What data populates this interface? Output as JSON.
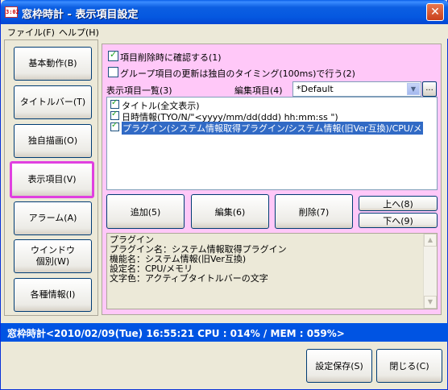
{
  "window": {
    "title": "窓枠時計 - 表示項目設定",
    "icon_text": "3:02",
    "close_glyph": "✕"
  },
  "menu": {
    "file": "ファイル(F)",
    "help": "ヘルプ(H)"
  },
  "nav": {
    "items": [
      {
        "label": "基本動作(B)"
      },
      {
        "label": "タイトルバー(T)"
      },
      {
        "label": "独自描画(O)"
      },
      {
        "label": "表示項目(V)"
      },
      {
        "label": "アラーム(A)"
      },
      {
        "label": "ウインドウ\n個別(W)"
      },
      {
        "label": "各種情報(I)"
      }
    ],
    "selected_index": 3
  },
  "options": {
    "confirm_delete": {
      "label": "項目削除時に確認する(1)",
      "checked": true
    },
    "group_update": {
      "label": "グループ項目の更新は独自のタイミング(100ms)で行う(2)",
      "checked": false
    }
  },
  "list": {
    "title": "表示項目一覧(3)",
    "edit_label": "編集項目(4)",
    "edit_value": "*Default",
    "more_button": "...",
    "rows": [
      {
        "text": "タイトル(全文表示)",
        "checked": true,
        "selected": false
      },
      {
        "text": "日時情報(TYO/N/\"<yyyy/mm/dd(ddd) hh:mm:ss \")",
        "checked": true,
        "selected": false
      },
      {
        "text": "プラグイン(システム情報取得プラグイン/システム情報(旧Ver互換)/CPU/メ",
        "checked": true,
        "selected": true
      }
    ]
  },
  "actions": {
    "add": "追加(5)",
    "edit": "編集(6)",
    "delete": "削除(7)",
    "up": "上へ(8)",
    "down": "下へ(9)"
  },
  "info": {
    "lines": [
      "プラグイン",
      "プラグイン名：システム情報取得プラグイン",
      "機能名：システム情報(旧Ver互換)",
      "設定名：CPU/メモリ",
      "文字色：アクティブタイトルバーの文字"
    ]
  },
  "status": {
    "text": "窓枠時計<2010/02/09(Tue) 16:55:21 CPU : 014% / MEM : 059%>"
  },
  "footer": {
    "save": "設定保存(S)",
    "close": "閉じる(C)"
  },
  "colors": {
    "panel_bg": "#ffc8f8",
    "selected_border": "#e040e0",
    "status_bg": "#0054e3",
    "selection_bg": "#316ac5"
  }
}
